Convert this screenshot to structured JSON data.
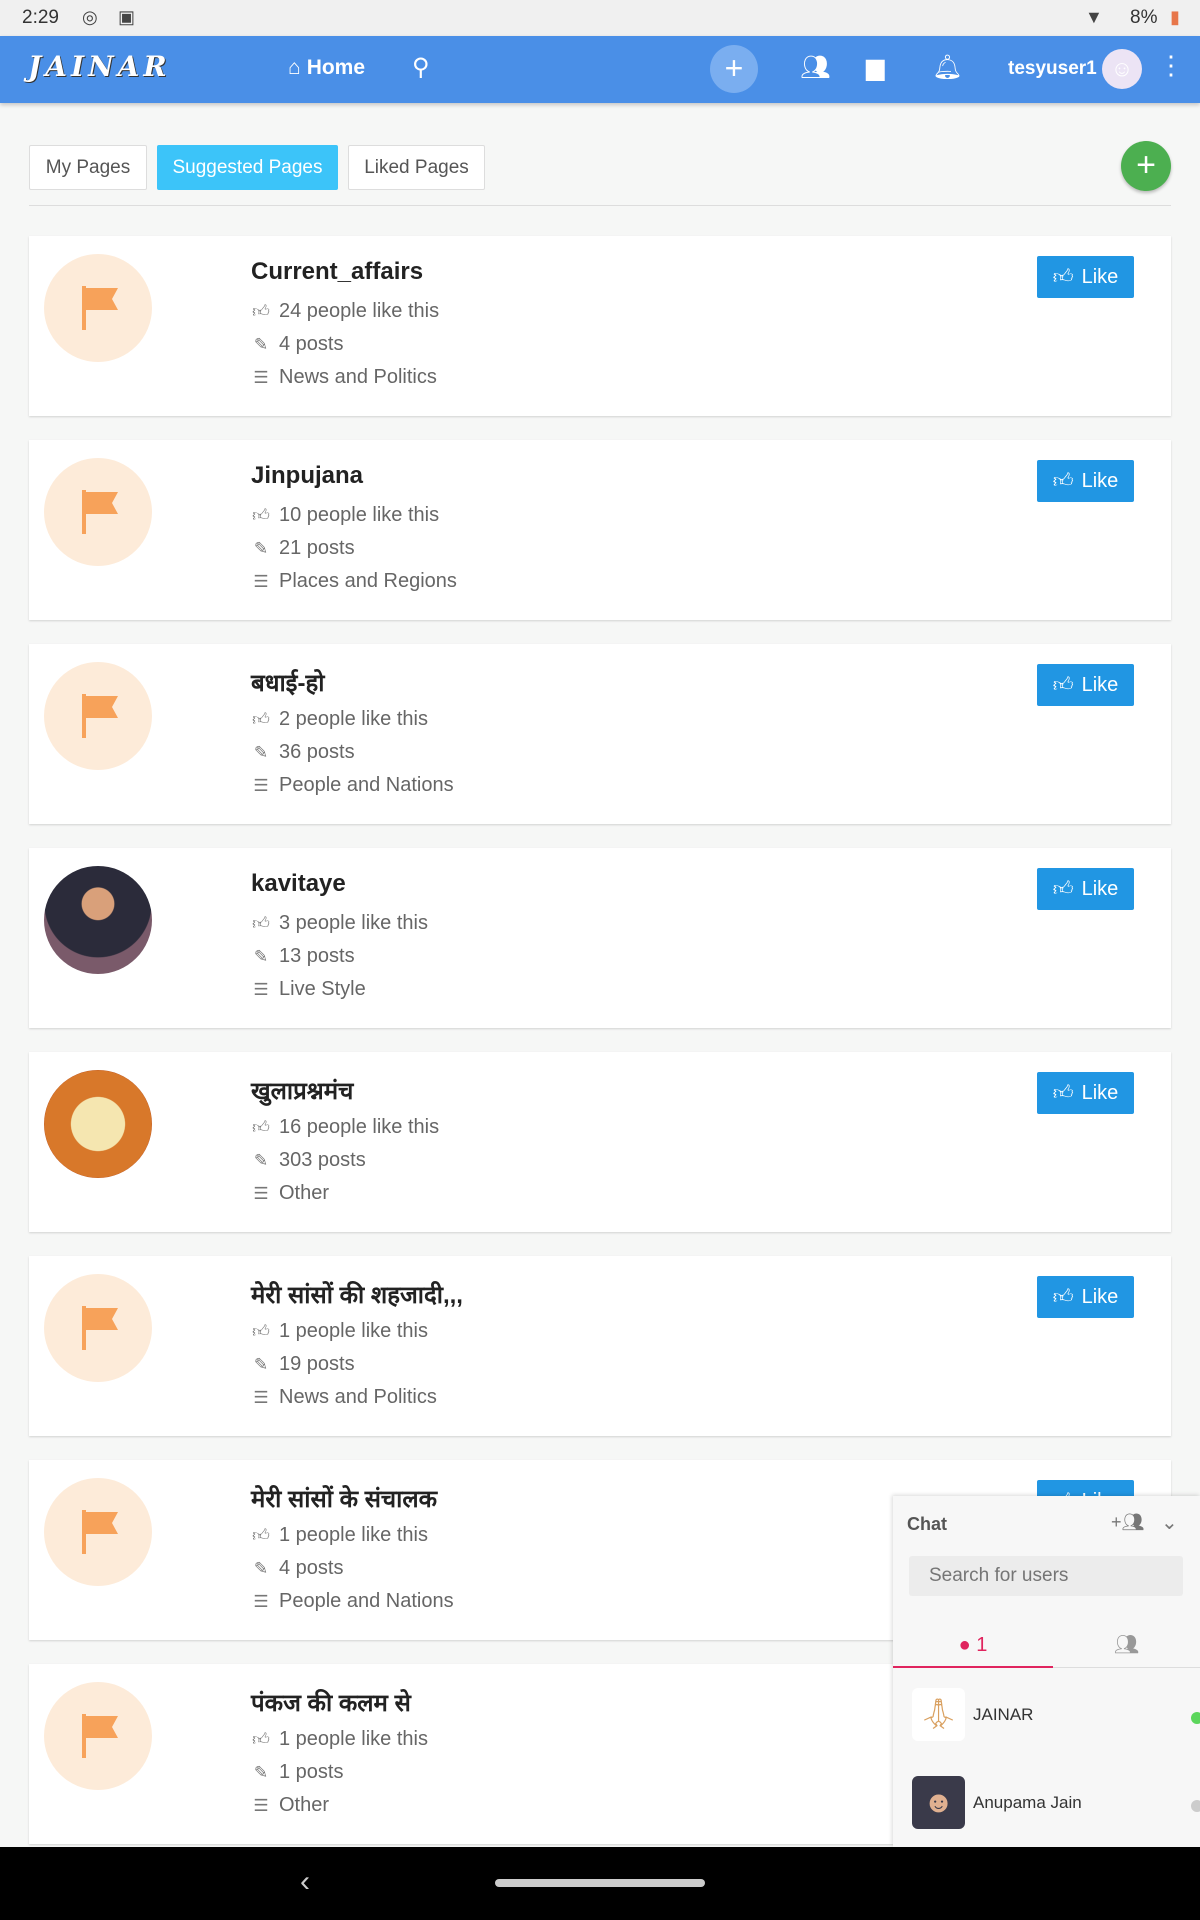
{
  "status_bar": {
    "time": "2:29",
    "battery": "8%"
  },
  "header": {
    "logo": "JAINAR",
    "home_label": "Home",
    "username": "tesyuser1"
  },
  "tabs": [
    {
      "label": "My Pages"
    },
    {
      "label": "Suggested Pages",
      "active": true
    },
    {
      "label": "Liked Pages"
    }
  ],
  "like_label": "Like",
  "pages": [
    {
      "name": "Current_affairs",
      "likes": "24 people like this",
      "posts": "4 posts",
      "category": "News and Politics",
      "avatar": "flag"
    },
    {
      "name": "Jinpujana",
      "likes": "10 people like this",
      "posts": "21 posts",
      "category": "Places and Regions",
      "avatar": "flag"
    },
    {
      "name": "बधाई-हो",
      "likes": "2 people like this",
      "posts": "36 posts",
      "category": "People and Nations",
      "avatar": "flag"
    },
    {
      "name": "kavitaye",
      "likes": "3 people like this",
      "posts": "13 posts",
      "category": "Live Style",
      "avatar": "photo"
    },
    {
      "name": "खुलाप्रश्नमंच",
      "likes": "16 people like this",
      "posts": "303 posts",
      "category": "Other",
      "avatar": "photo"
    },
    {
      "name": "मेरी सांसों की शहजादी,,,",
      "likes": "1 people like this",
      "posts": "19 posts",
      "category": "News and Politics",
      "avatar": "flag"
    },
    {
      "name": "मेरी सांसों के संचालक",
      "likes": "1 people like this",
      "posts": "4 posts",
      "category": "People and Nations",
      "avatar": "flag"
    },
    {
      "name": "पंकज की कलम से",
      "likes": "1 people like this",
      "posts": "1 posts",
      "category": "Other",
      "avatar": "flag"
    }
  ],
  "chat": {
    "title": "Chat",
    "search_placeholder": "Search for users",
    "online_count": "1",
    "users": [
      {
        "name": "JAINAR",
        "online": true
      },
      {
        "name": "Anupama Jain",
        "online": false
      }
    ]
  },
  "colors": {
    "header": "#4a8fe7",
    "active_tab": "#3cc4f9",
    "like_button": "#2196e3",
    "add_button": "#4caf50",
    "flag": "#f7a25a",
    "chat_accent": "#e0245e"
  }
}
